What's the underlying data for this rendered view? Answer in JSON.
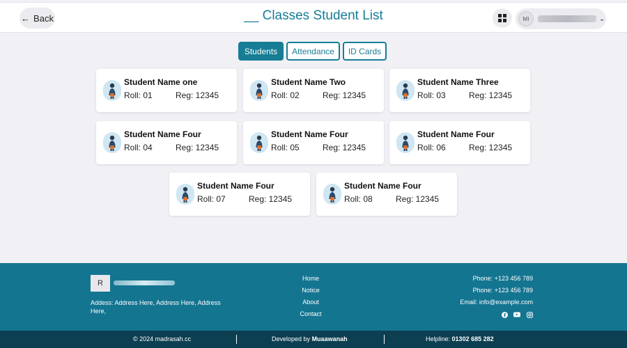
{
  "header": {
    "back_label": "Back",
    "title": "__ Classes Student List",
    "user_initials": "MI"
  },
  "tabs": [
    {
      "label": "Students",
      "active": true
    },
    {
      "label": "Attendance",
      "active": false
    },
    {
      "label": "ID Cards",
      "active": false
    }
  ],
  "students": [
    {
      "name": "Student Name one",
      "roll": "Roll: 01",
      "reg": "Reg: 12345"
    },
    {
      "name": "Student Name Two",
      "roll": "Roll: 02",
      "reg": "Reg: 12345"
    },
    {
      "name": "Student Name Three",
      "roll": "Roll: 03",
      "reg": "Reg: 12345"
    },
    {
      "name": "Student Name Four",
      "roll": "Roll: 04",
      "reg": "Reg: 12345"
    },
    {
      "name": "Student Name Four",
      "roll": "Roll: 05",
      "reg": "Reg: 12345"
    },
    {
      "name": "Student Name Four",
      "roll": "Roll: 06",
      "reg": "Reg: 12345"
    },
    {
      "name": "Student Name Four",
      "roll": "Roll: 07",
      "reg": "Reg: 12345"
    },
    {
      "name": "Student Name Four",
      "roll": "Roll: 08",
      "reg": "Reg: 12345"
    }
  ],
  "footer": {
    "logo_letter": "R",
    "address": "Addess: Address Here, Address Here, Address Here,",
    "links": [
      "Home",
      "Notice",
      "About",
      "Contact"
    ],
    "phone_1": "Phone: +123 456 789",
    "phone_2": "Phone: +123 456 789",
    "email": "Email: info@example.com",
    "socials": [
      "facebook-icon",
      "youtube-icon",
      "instagram-icon"
    ]
  },
  "bottom_bar": {
    "copyright": "© 2024 madrasah.cc",
    "developed_prefix": "Developed by",
    "developer": "Muaawanah",
    "helpline_prefix": "Helpline:",
    "helpline_number": "01302 685 282"
  },
  "colors": {
    "accent": "#167d95",
    "footer_bg": "#147591",
    "bottom_bar_bg": "#0d3f52",
    "page_bg": "#f0f0f5"
  }
}
